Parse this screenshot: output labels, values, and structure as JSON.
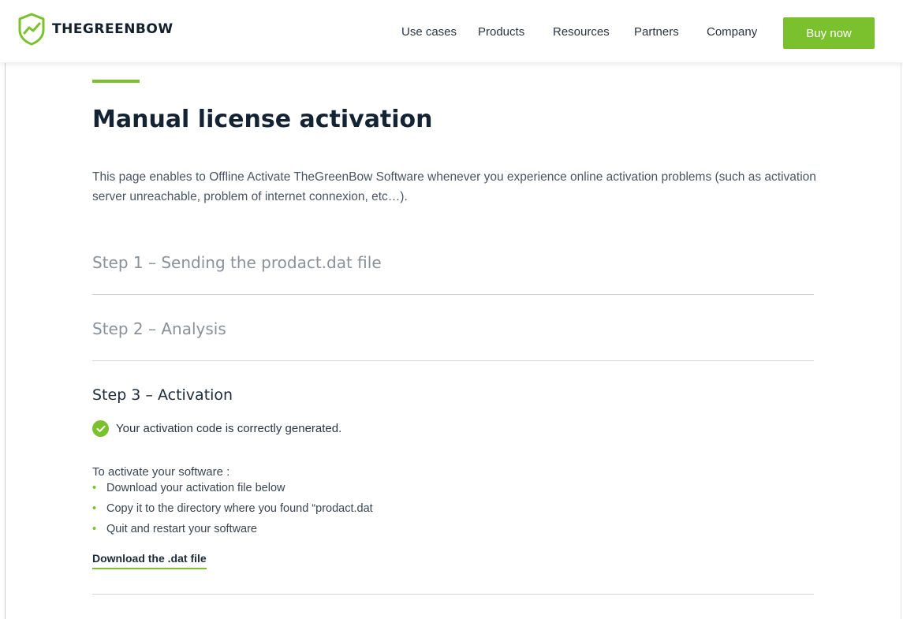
{
  "header": {
    "logo_text": "THEGREENBOW",
    "nav": [
      "Use cases",
      "Products",
      "Resources",
      "Partners",
      "Company"
    ],
    "buy_label": "Buy now"
  },
  "colors": {
    "accent": "#7bc12e",
    "title": "#142333"
  },
  "icons": {
    "logo": "shield-chart-icon",
    "status": "check-circle-icon"
  },
  "page": {
    "title": "Manual license activation",
    "intro": "This page enables to Offline Activate TheGreenBow Software whenever you experience online activation problems (such as activation server unreachable, problem of internet connexion, etc…)."
  },
  "steps": [
    {
      "title": "Step 1 – Sending the prodact.dat file"
    },
    {
      "title": "Step 2 – Analysis"
    },
    {
      "title": "Step 3 – Activation"
    }
  ],
  "activation": {
    "success_message": "Your activation code is correctly generated.",
    "instructions_title": "To activate your software :",
    "instructions": [
      "Download your activation file below",
      "Copy it to the directory where you found “prodact.dat",
      "Quit and restart your software"
    ],
    "download_label": "Download the .dat file"
  }
}
